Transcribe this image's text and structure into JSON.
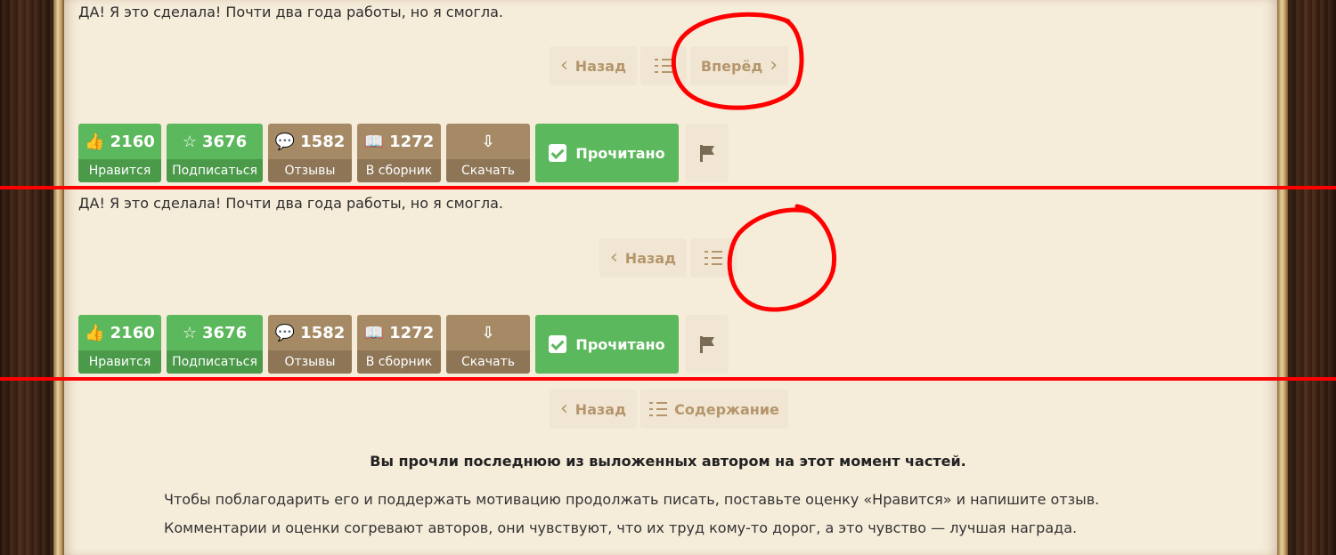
{
  "top_text": "ДА! Я это сделала! Почти два года работы, но я смогла.",
  "nav_top": {
    "back": "Назад",
    "forward": "Вперёд"
  },
  "nav_bottom": {
    "back": "Назад",
    "contents": "Содержание"
  },
  "stats": [
    {
      "count": "2160",
      "label": "Нравится",
      "icon": "thumbs-up-icon"
    },
    {
      "count": "3676",
      "label": "Подписаться",
      "icon": "star-icon"
    },
    {
      "count": "1582",
      "label": "Отзывы",
      "icon": "comment-icon"
    },
    {
      "count": "1272",
      "label": "В сборник",
      "icon": "book-icon"
    },
    {
      "count": "",
      "label": "Скачать",
      "icon": "download-icon"
    }
  ],
  "read_label": "Прочитано",
  "final": {
    "heading": "Вы прочли последнюю из выложенных автором на этот момент частей.",
    "line1": "Чтобы поблагодарить его и поддержать мотивацию продолжать писать, поставьте оценку «Нравится» и напишите отзыв.",
    "line2": "Комментарии и оценки согревают авторов, они чувствуют, что их труд кому-то дорог, а это чувство — лучшая награда."
  },
  "colors": {
    "green": "#5cb85c",
    "brown": "#a68a66",
    "annotation": "#ff0000"
  }
}
